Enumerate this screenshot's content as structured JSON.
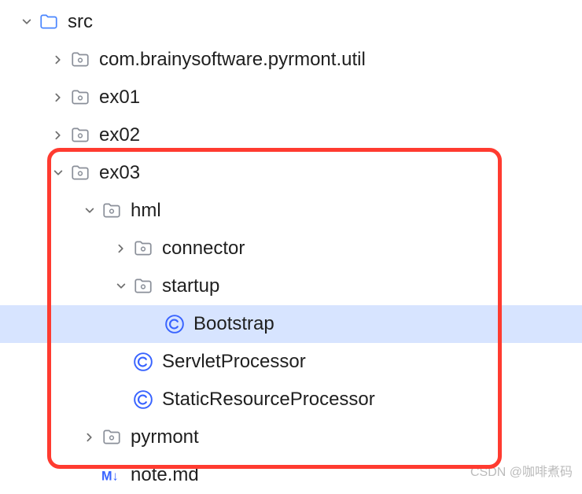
{
  "tree": {
    "src": "src",
    "util": "com.brainysoftware.pyrmont.util",
    "ex01": "ex01",
    "ex02": "ex02",
    "ex03": "ex03",
    "hml": "hml",
    "connector": "connector",
    "startup": "startup",
    "bootstrap": "Bootstrap",
    "servletprocessor": "ServletProcessor",
    "staticprocessor": "StaticResourceProcessor",
    "pyrmont": "pyrmont",
    "note": "note.md"
  },
  "watermark": "CSDN @咖啡煮码"
}
